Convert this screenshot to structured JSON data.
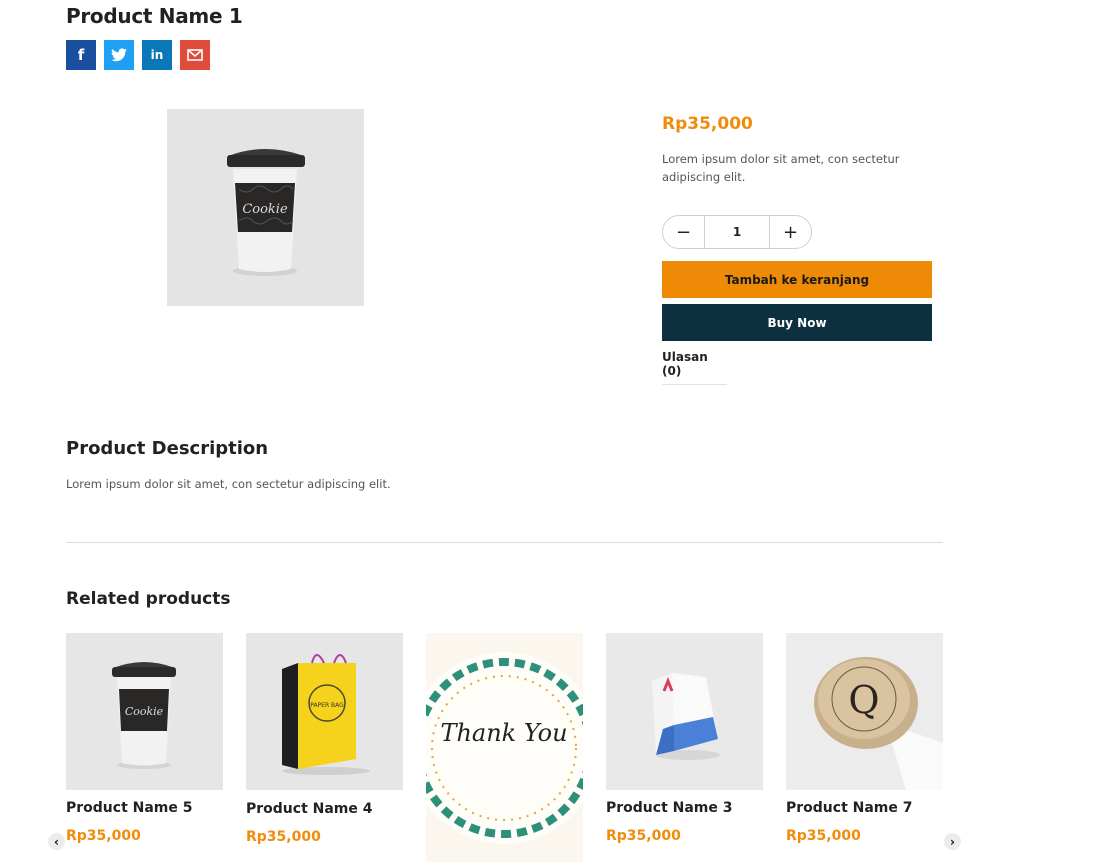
{
  "product": {
    "title": "Product Name 1",
    "price": "Rp35,000",
    "short_description": "Lorem ipsum dolor sit amet, con sectetur adipiscing elit.",
    "quantity": "1",
    "add_to_cart_label": "Tambah ke keranjang",
    "buy_now_label": "Buy Now",
    "reviews_tab_label": "Ulasan (0)",
    "image_label": "Cookie"
  },
  "share": {
    "facebook": "f",
    "twitter": "t",
    "linkedin": "in",
    "email": "✉"
  },
  "description": {
    "heading": "Product Description",
    "text": "Lorem ipsum dolor sit amet, con sectetur adipiscing elit."
  },
  "related": {
    "heading": "Related products",
    "items": [
      {
        "name": "Product Name 5",
        "price": "Rp35,000",
        "image": "coffee-cup",
        "image_label": "Cookie"
      },
      {
        "name": "Product Name 4",
        "price": "Rp35,000",
        "image": "paper-bag",
        "image_label": "PAPER BAG"
      },
      {
        "name": "",
        "price": "",
        "image": "thank-you-sticker",
        "image_label": "Thank You"
      },
      {
        "name": "Product Name 3",
        "price": "Rp35,000",
        "image": "box"
      },
      {
        "name": "Product Name 7",
        "price": "Rp35,000",
        "image": "wine-cork",
        "image_label": "Q"
      }
    ]
  },
  "carousel": {
    "prev": "‹",
    "next": "›"
  },
  "colors": {
    "accent": "#f08c0a",
    "dark": "#0c3040"
  }
}
